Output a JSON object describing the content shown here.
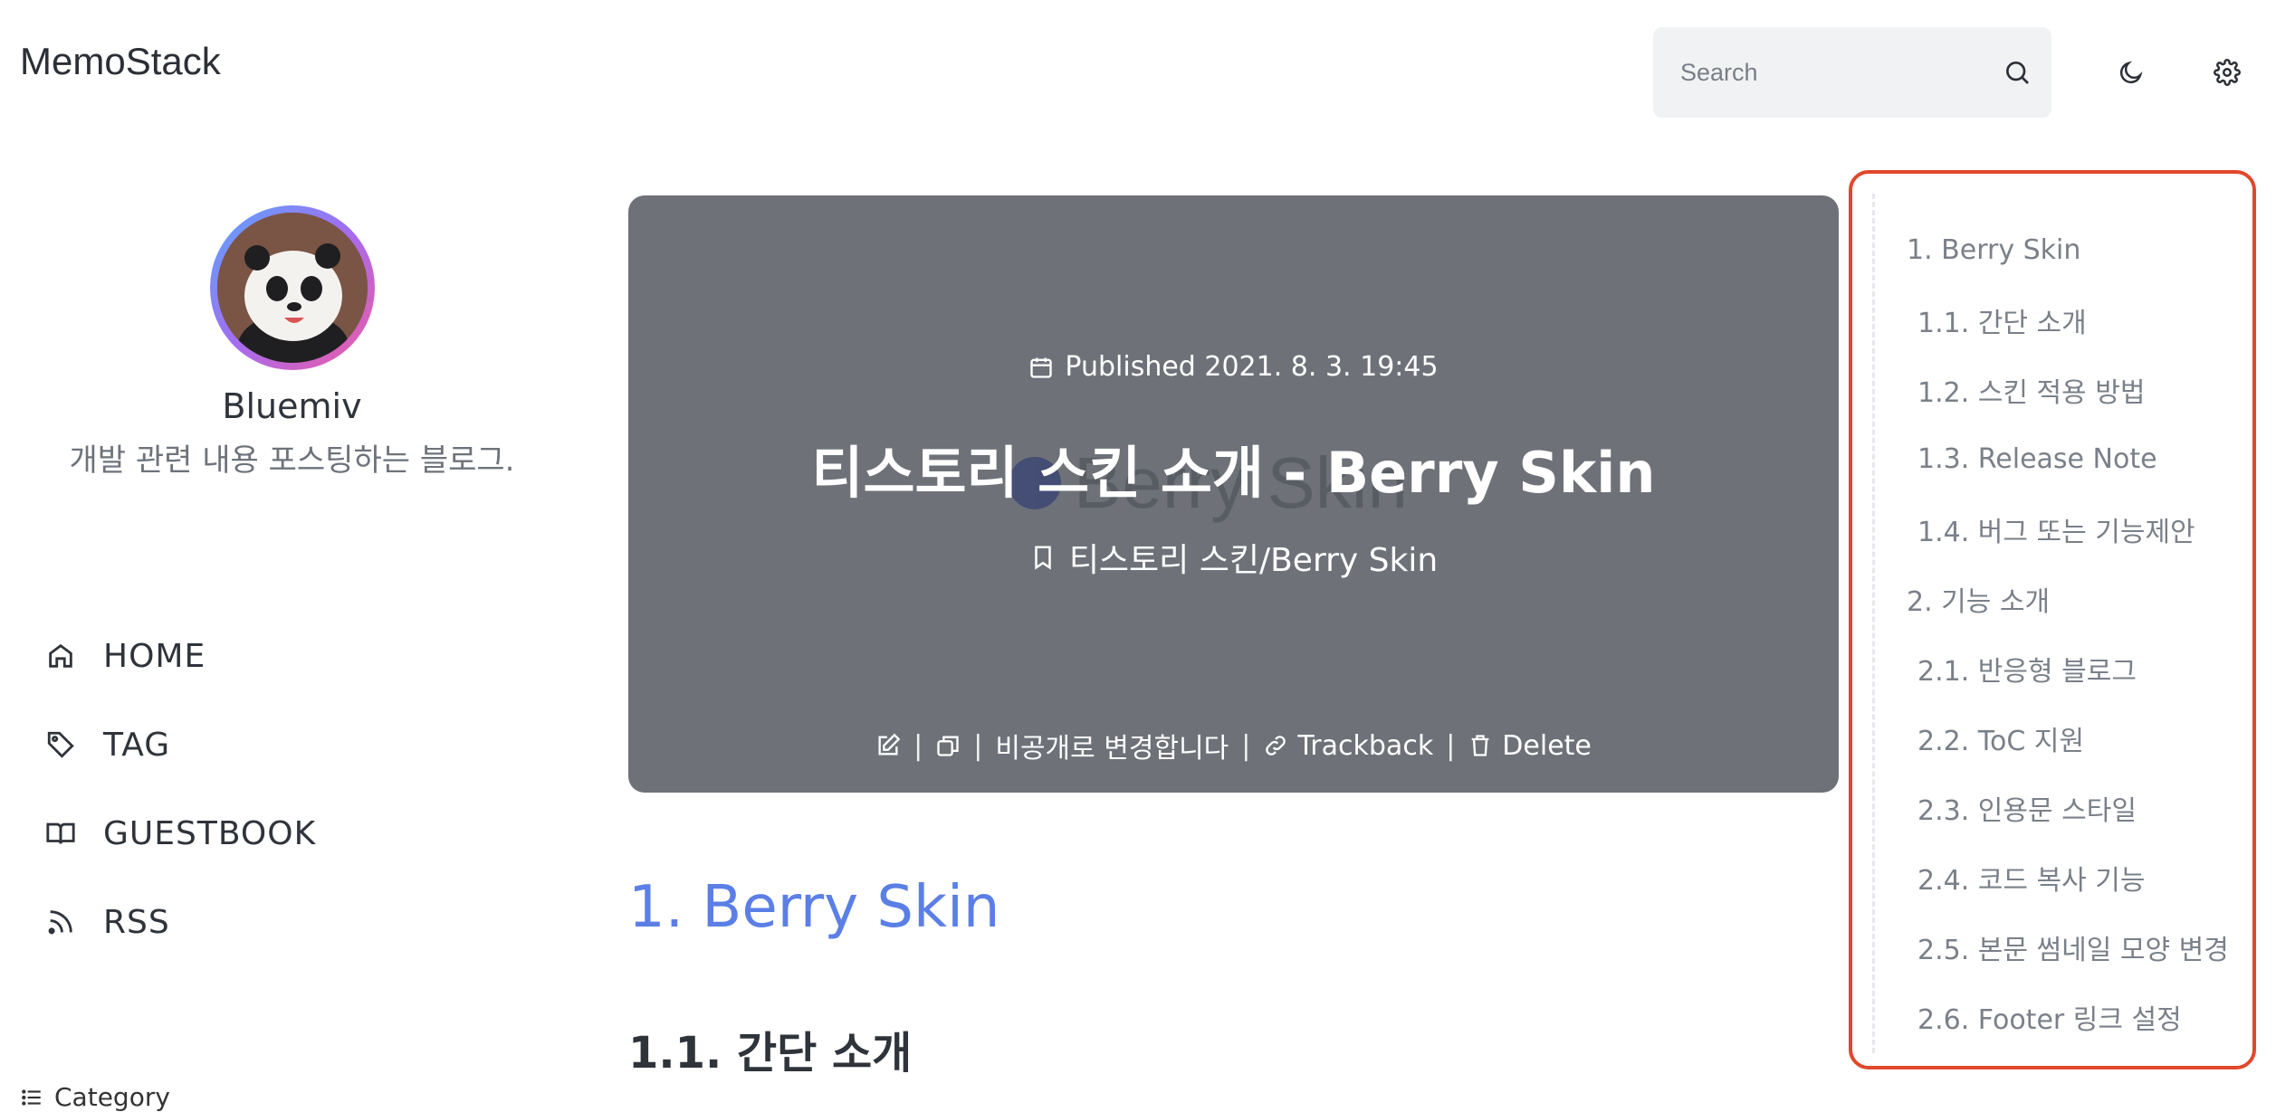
{
  "header": {
    "brand": "MemoStack",
    "search_placeholder": "Search",
    "icons": [
      "search-icon",
      "moon-icon",
      "gear-icon"
    ]
  },
  "profile": {
    "name": "Bluemiv",
    "description": "개발 관련 내용 포스팅하는 블로그."
  },
  "nav": {
    "items": [
      {
        "label": "HOME",
        "icon": "home-icon"
      },
      {
        "label": "TAG",
        "icon": "tag-icon"
      },
      {
        "label": "GUESTBOOK",
        "icon": "book-icon"
      },
      {
        "label": "RSS",
        "icon": "rss-icon"
      }
    ],
    "category_label": "Category"
  },
  "post": {
    "published": "Published 2021. 8. 3. 19:45",
    "title": "티스토리 스킨 소개 - Berry Skin",
    "category": "티스토리 스킨/Berry Skin",
    "thumbnail_text": "Berry Skin",
    "actions": {
      "private_toggle": "비공개로 변경합니다",
      "trackback": "Trackback",
      "delete": "Delete"
    }
  },
  "content": {
    "h1": "1. Berry Skin",
    "h2": "1.1. 간단 소개"
  },
  "toc": {
    "items": [
      {
        "label": "1. Berry Skin",
        "level": 1
      },
      {
        "label": "1.1. 간단 소개",
        "level": 2
      },
      {
        "label": "1.2. 스킨 적용 방법",
        "level": 2
      },
      {
        "label": "1.3. Release Note",
        "level": 2
      },
      {
        "label": "1.4. 버그 또는 기능제안",
        "level": 2
      },
      {
        "label": "2. 기능 소개",
        "level": 1
      },
      {
        "label": "2.1. 반응형 블로그",
        "level": 2
      },
      {
        "label": "2.2. ToC 지원",
        "level": 2
      },
      {
        "label": "2.3. 인용문 스타일",
        "level": 2
      },
      {
        "label": "2.4. 코드 복사 기능",
        "level": 2
      },
      {
        "label": "2.5. 본문 썸네일 모양 변경",
        "level": 2
      },
      {
        "label": "2.6. Footer 링크 설정",
        "level": 2
      }
    ]
  },
  "colors": {
    "accent": "#5b7fe6",
    "highlight_border": "#e0482b",
    "hero_bg": "#6e7278"
  }
}
